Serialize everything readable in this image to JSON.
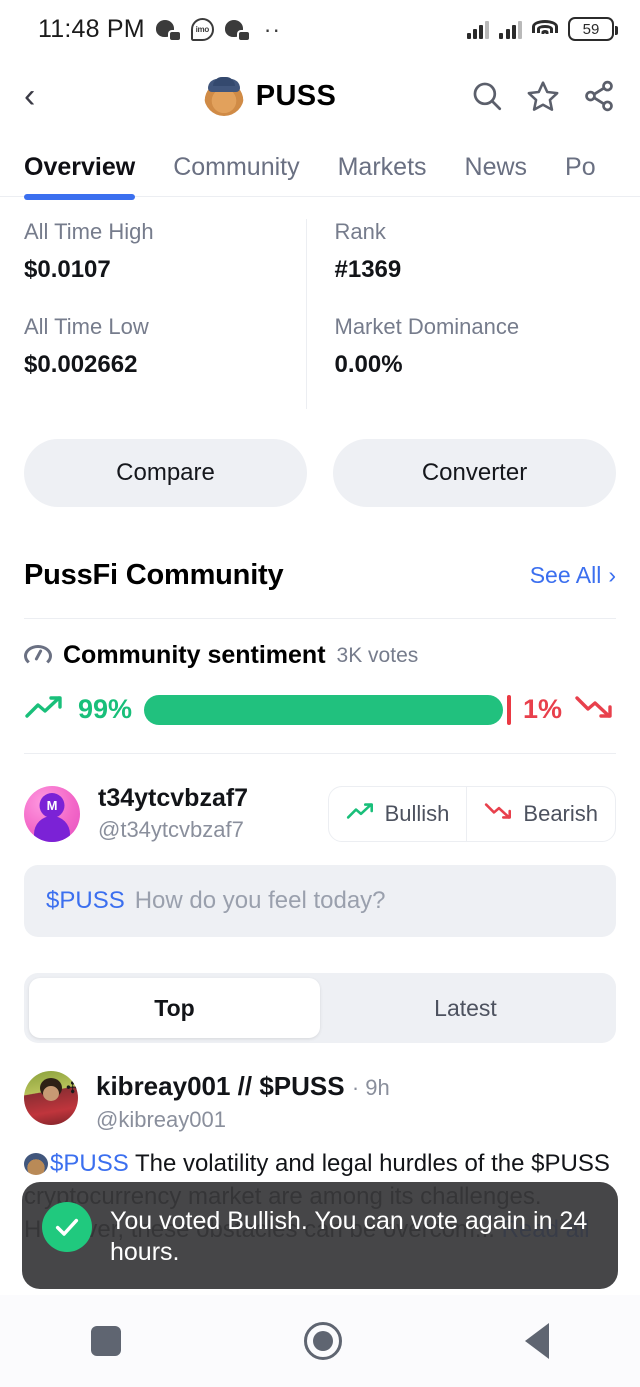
{
  "status_bar": {
    "time": "11:48 PM",
    "battery_percent": "59",
    "icons": [
      "app-notification-icon",
      "imo-icon",
      "app-notification-icon",
      "more-dots-icon",
      "signal-bars-icon",
      "signal-bars-icon",
      "wifi-icon",
      "battery-icon"
    ]
  },
  "header": {
    "back_icon": "chevron-left-icon",
    "coin_name": "PUSS",
    "coin_avatar": "cat-with-hat-avatar",
    "actions": [
      "search-icon",
      "star-icon",
      "share-icon"
    ]
  },
  "tabs": [
    {
      "label": "Overview",
      "active": true
    },
    {
      "label": "Community",
      "active": false
    },
    {
      "label": "Markets",
      "active": false
    },
    {
      "label": "News",
      "active": false
    },
    {
      "label": "Po",
      "active": false
    }
  ],
  "stats": {
    "left": [
      {
        "label": "All Time High",
        "value": "$0.0107"
      },
      {
        "label": "All Time Low",
        "value": "$0.002662"
      }
    ],
    "right": [
      {
        "label": "Rank",
        "value": "#1369"
      },
      {
        "label": "Market Dominance",
        "value": "0.00%"
      }
    ]
  },
  "action_pills": [
    {
      "label": "Compare"
    },
    {
      "label": "Converter"
    }
  ],
  "community": {
    "section_title": "PussFi Community",
    "see_all_label": "See All",
    "sentiment": {
      "title": "Community sentiment",
      "votes": "3K votes",
      "bullish_percent": "99%",
      "bearish_percent": "1%",
      "bullish_value": 99,
      "bearish_value": 1,
      "bullish_color": "#21c17e",
      "bearish_color": "#ea3943"
    },
    "voter": {
      "name": "t34ytcvbzaf7",
      "handle": "@t34ytcvbzaf7",
      "bullish_label": "Bullish",
      "bearish_label": "Bearish"
    },
    "post_input": {
      "cashtag": "$PUSS",
      "placeholder": "How do you feel today?"
    },
    "segmented": [
      {
        "label": "Top",
        "active": true
      },
      {
        "label": "Latest",
        "active": false
      }
    ],
    "feed": [
      {
        "name": "kibreay001 // $PUSS",
        "time": "· 9h",
        "handle": "@kibreay001",
        "cashtag": "$PUSS",
        "body": "The volatility and legal hurdles of the $PUSS cryptocurrency market are among its challenges. However, these obstacles can be overcom...",
        "read_all_label": "Read all"
      }
    ]
  },
  "toast": {
    "message": "You voted Bullish. You can vote again in 24 hours.",
    "icon": "check-circle-icon",
    "accent_color": "#20c97e"
  },
  "nav_bar": {
    "items": [
      "recents-square-icon",
      "home-circle-icon",
      "back-triangle-icon"
    ]
  }
}
